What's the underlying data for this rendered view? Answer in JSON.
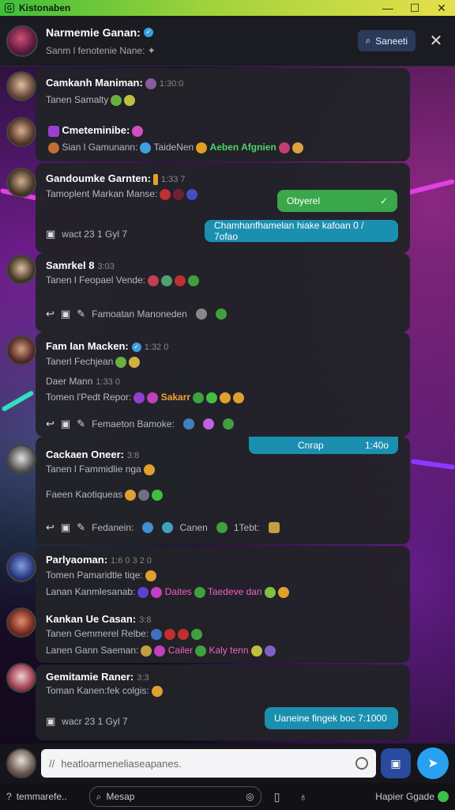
{
  "window": {
    "title": "Kistonaben",
    "controls": [
      "—",
      "☐",
      "✕"
    ]
  },
  "header": {
    "name": "Narmemie Ganan:",
    "subtitle": "Sanm l fenotenie Nane:",
    "search_label": "Saneeti",
    "close_label": "✕"
  },
  "messages": [
    {
      "user": "Camkanh Maniman:",
      "time": "1:30:0",
      "line1": "Tanen Samalty"
    },
    {
      "user": "Cmeteminibe:",
      "line1": "Sian l Gamunann:",
      "tag1": "TaideNen",
      "tag2": "Aeben Afgnien"
    },
    {
      "user": "Gandoumke Garnten:",
      "time": "1:33 7",
      "line1": "Tamoplent Markan Manse:",
      "pill": "Obyerel",
      "footer": "wact 23 1 Gyl 7",
      "reply": "Chamhanfhamelan hiake kafoan 0 / 7ofao"
    },
    {
      "user": "Samrkel 8",
      "time": "3:03",
      "line1": "Tanen l Feopael Vende:",
      "footer": "Famoatan Manoneden"
    },
    {
      "user": "Fam Ian Macken:",
      "time": "1:32 0",
      "line1": "Tanerl Fechjean",
      "line2": "Daer Mann",
      "time2": "1:33 0",
      "line3": "Tomen l'Pedt Repor:",
      "tag3": "Sakarr",
      "footer": "Femaeton Bamoke:"
    },
    {
      "user": "Cackaen Oneer:",
      "time": "3:8",
      "line1": "Tanen l Fammidlie nga",
      "line2": "Faeen Kaotiqueas",
      "footer": "Fedanein:",
      "tag1": "Canen",
      "tag2": "1Tebt:",
      "pill": "Cnrap",
      "pill_right": "1:40o"
    },
    {
      "user": "Parlyaoman:",
      "time": "1:6 0 3 2 0",
      "line1": "Tomen Pamaridtle tiqe:",
      "line2": "Lanan Kanmlesanab:",
      "tag1": "Daites",
      "tag2": "Taedeve dan"
    },
    {
      "user": "Kankan Ue Casan:",
      "time": "3:8",
      "line1": "Tanen Gemmerel Relbe:",
      "line2": "Lanen Gann Saeman:",
      "tag1": "Cailer",
      "tag2": "Kaly tenn"
    },
    {
      "user": "Gemitamie Raner:",
      "time": "3:3",
      "line1": "Toman Kanen:fek colgis:",
      "footer": "wacr 23 1 Gyl 7",
      "reply": "Uaneine fingek boc 7:1000"
    }
  ],
  "composer": {
    "placeholder": "heatloarmeneliaseapanes."
  },
  "statusbar": {
    "left_label": "temmarefe..",
    "search_label": "Mesap",
    "right_label": "Hapier Ggade"
  }
}
